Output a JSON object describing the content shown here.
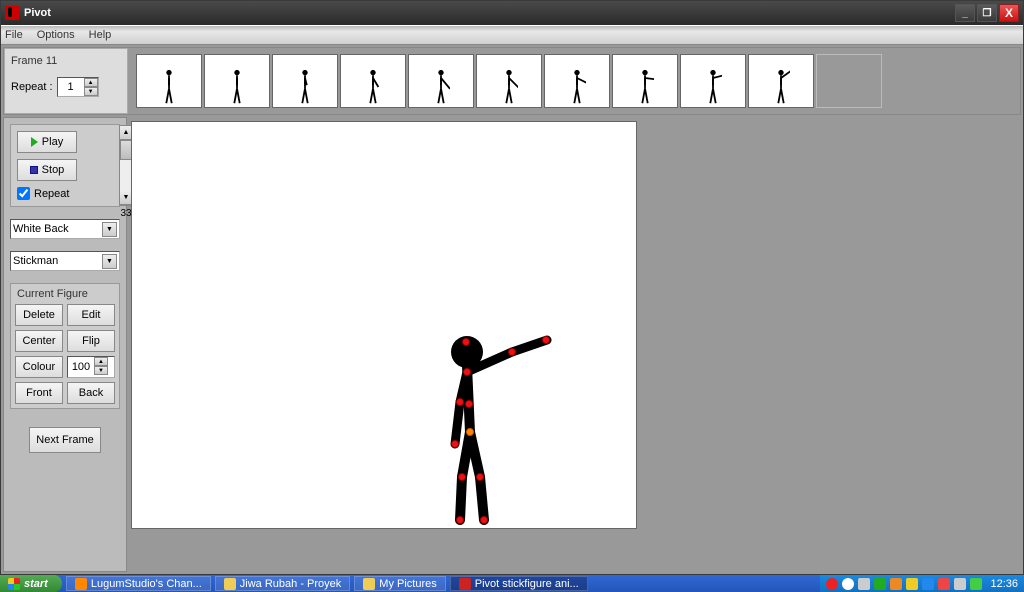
{
  "window": {
    "title": "Pivot",
    "minimize": "_",
    "maximize": "❐",
    "close": "X"
  },
  "menu": {
    "file": "File",
    "options": "Options",
    "help": "Help"
  },
  "timeline": {
    "frame_label": "Frame 11",
    "repeat_label": "Repeat :",
    "repeat_value": "1",
    "frame_count": 10
  },
  "controls": {
    "play": "Play",
    "stop": "Stop",
    "repeat": "Repeat",
    "repeat_checked": true,
    "scroll_value": "33"
  },
  "dropdowns": {
    "background": "White Back",
    "figure": "Stickman"
  },
  "figure_box": {
    "title": "Current Figure",
    "delete": "Delete",
    "edit": "Edit",
    "center": "Center",
    "flip": "Flip",
    "colour": "Colour",
    "scale_value": "100",
    "front": "Front",
    "back": "Back"
  },
  "next_frame": "Next Frame",
  "taskbar": {
    "start": "start",
    "items": [
      "LugumStudio's Chan...",
      "Jiwa Rubah - Proyek",
      "My Pictures",
      "Pivot stickfigure ani..."
    ],
    "clock": "12:36"
  }
}
